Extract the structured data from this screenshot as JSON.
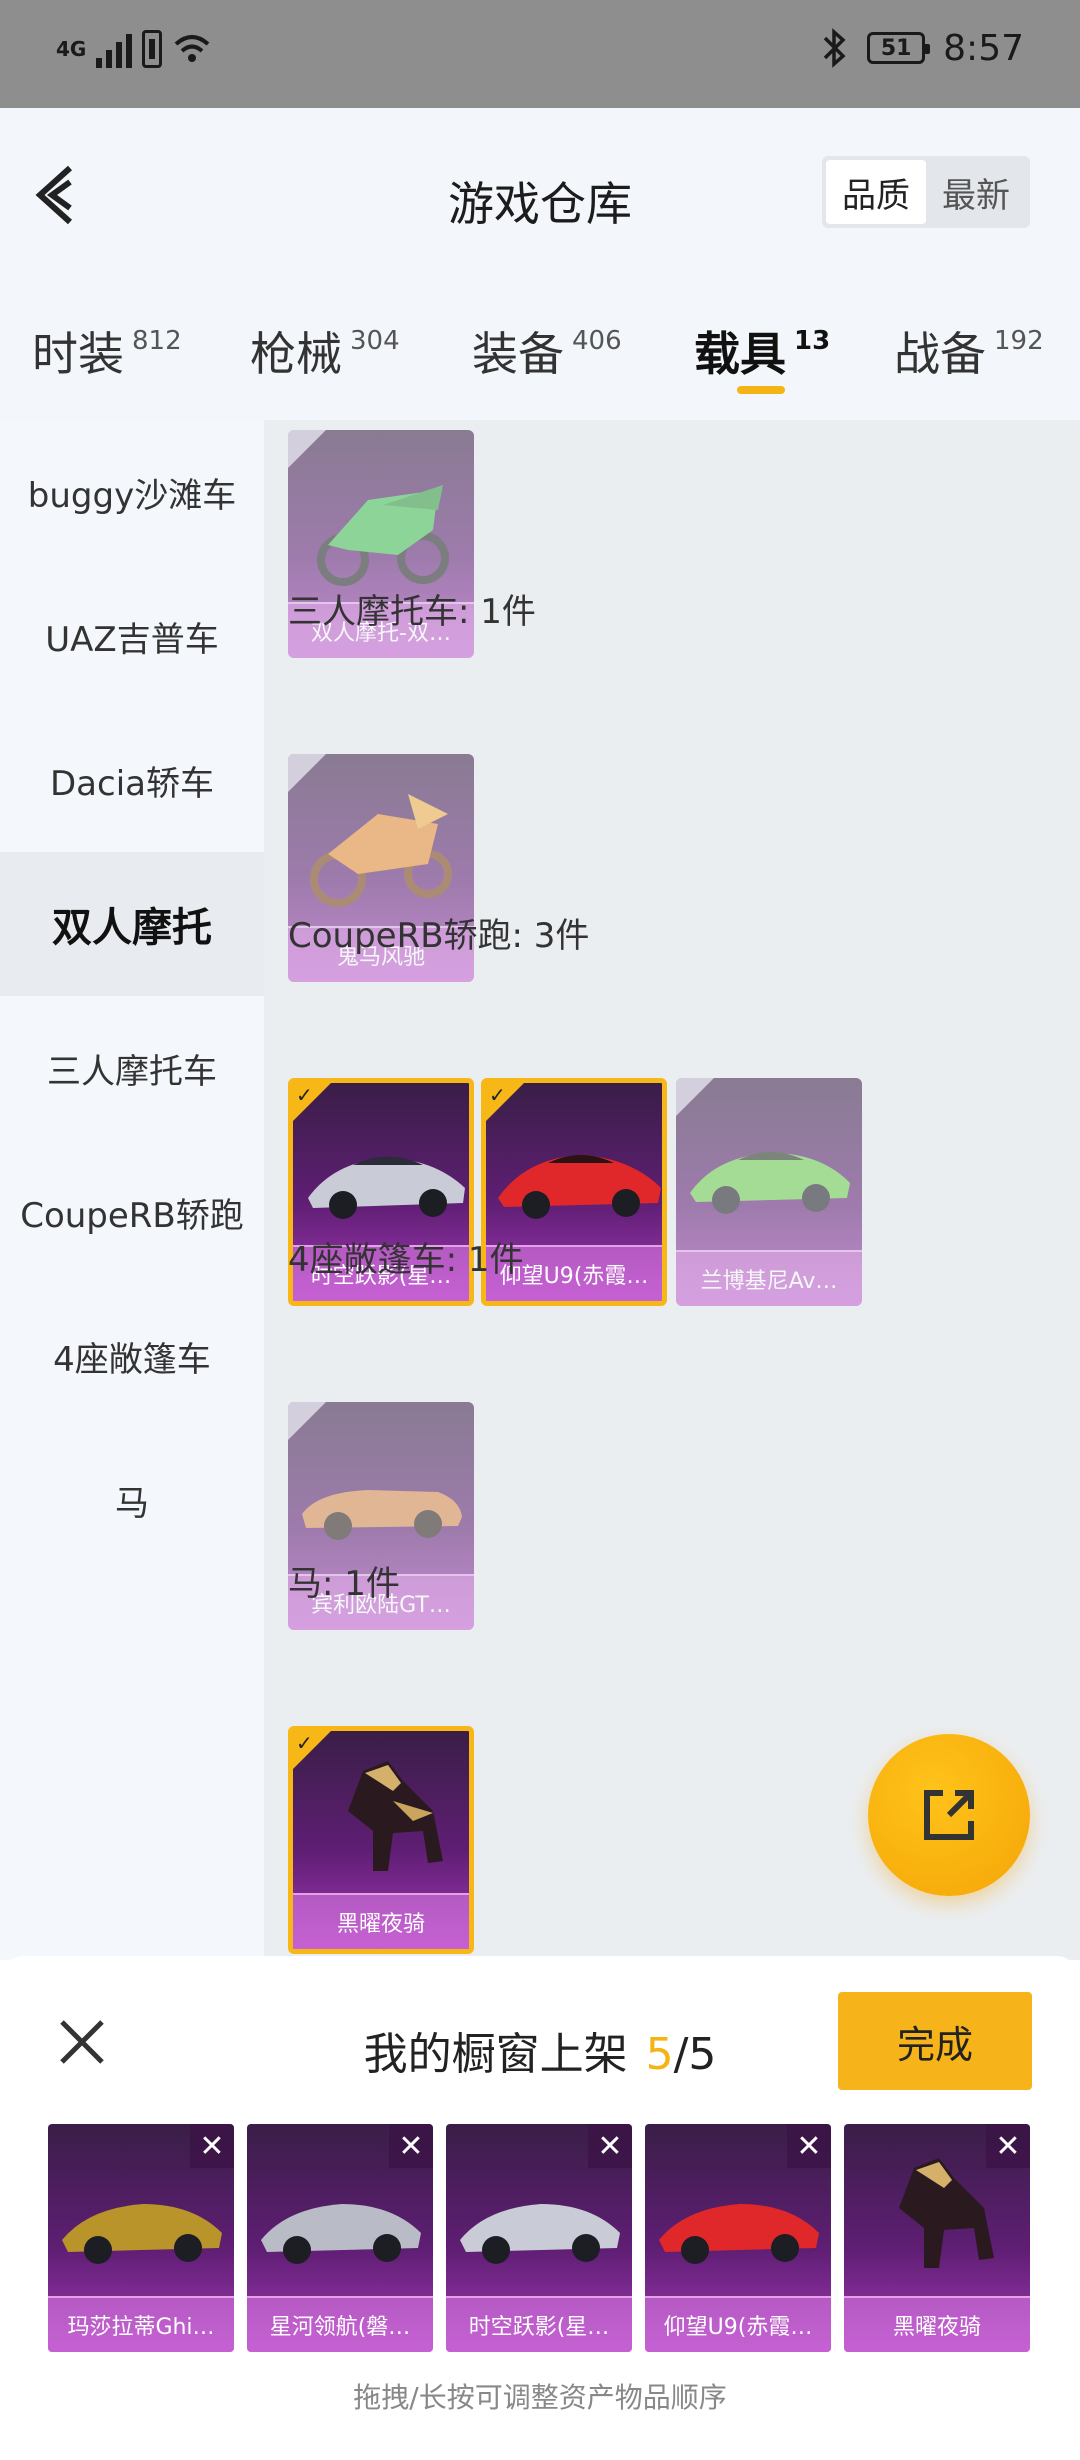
{
  "status_bar": {
    "network": "4G",
    "battery": "51",
    "time": "8:57"
  },
  "header": {
    "title": "游戏仓库",
    "sort_quality": "品质",
    "sort_newest": "最新"
  },
  "tabs": [
    {
      "label": "时装",
      "count": "812"
    },
    {
      "label": "枪械",
      "count": "304"
    },
    {
      "label": "装备",
      "count": "406"
    },
    {
      "label": "载具",
      "count": "13"
    },
    {
      "label": "战备",
      "count": "192"
    }
  ],
  "sidebar": [
    "buggy沙滩车",
    "UAZ吉普车",
    "Dacia轿车",
    "双人摩托",
    "三人摩托车",
    "CoupeRB轿跑",
    "4座敞篷车",
    "马"
  ],
  "content": {
    "sections": [
      {
        "label": "三人摩托车: 1件"
      },
      {
        "label": "CoupeRB轿跑: 3件"
      },
      {
        "label": "4座敞篷车: 1件"
      },
      {
        "label": "马: 1件"
      }
    ],
    "cards": [
      {
        "name": "双人摩托-双…",
        "icon": "motorcycle-icon"
      },
      {
        "name": "鬼马风驰",
        "icon": "motorcycle-icon"
      },
      {
        "name": "时空跃影(星…",
        "icon": "sports-car-icon"
      },
      {
        "name": "仰望U9(赤霞…",
        "icon": "sports-car-icon"
      },
      {
        "name": "兰博基尼Av…",
        "icon": "sports-car-icon"
      },
      {
        "name": "宾利欧陆GT…",
        "icon": "convertible-icon"
      },
      {
        "name": "黑曜夜骑",
        "icon": "horse-icon"
      }
    ]
  },
  "panel": {
    "title": "我的橱窗上架",
    "count_current": "5",
    "count_total": "/5",
    "done_label": "完成",
    "remove_symbol": "✕",
    "hint": "拖拽/长按可调整资产物品顺序",
    "items": [
      {
        "name": "玛莎拉蒂Ghi…"
      },
      {
        "name": "星河领航(磐…"
      },
      {
        "name": "时空跃影(星…"
      },
      {
        "name": "仰望U9(赤霞…"
      },
      {
        "name": "黑曜夜骑"
      }
    ]
  },
  "colors": {
    "accent": "#f4b413",
    "card_purple": "#5f1e74",
    "card_foot": "#d98ae6"
  }
}
